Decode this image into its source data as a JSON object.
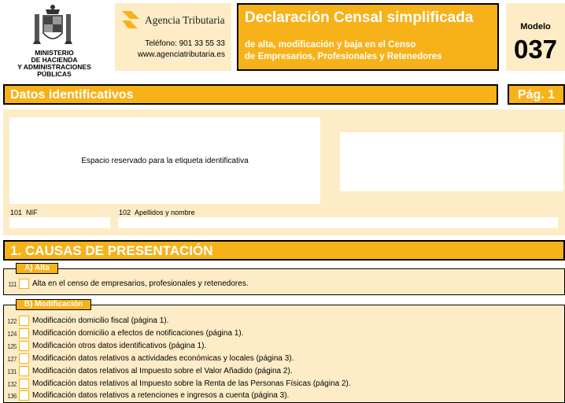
{
  "header": {
    "ministry_lines": [
      "MINISTERIO",
      "DE HACIENDA",
      "Y ADMINISTRACIONES PÚBLICAS"
    ],
    "agency_name": "Agencia Tributaria",
    "agency_phone": "Teléfono: 901 33 55 33",
    "agency_web": "www.agenciatributaria.es",
    "title": "Declaración Censal simplificada",
    "subtitle_line1": "de alta, modificación y baja en el Censo",
    "subtitle_line2": "de Empresarios, Profesionales y Retenedores",
    "model_label": "Modelo",
    "model_number": "037"
  },
  "ident": {
    "section_title": "Datos identificativos",
    "page_label": "Pág. 1",
    "label_space_text": "Espacio reservado para la etiqueta identificativa",
    "nif_code": "101",
    "nif_label": "NIF",
    "name_code": "102",
    "name_label": "Apellidos y nombre"
  },
  "causes": {
    "title": "1. CAUSAS DE PRESENTACIÓN",
    "alta": {
      "heading": "A) Alta",
      "items": [
        {
          "code": "111",
          "label": "Alta en el censo de empresarios, profesionales y retenedores."
        }
      ]
    },
    "modificacion": {
      "heading": "B) Modificación",
      "items": [
        {
          "code": "122",
          "label": "Modificación domicilio fiscal (página 1)."
        },
        {
          "code": "124",
          "label": "Modificación domicilio a efectos de notificaciones (página 1)."
        },
        {
          "code": "125",
          "label": "Modificación otros datos identificativos (página 1)."
        },
        {
          "code": "127",
          "label": "Modificación datos relativos a actividades económicas y locales (página 3)."
        },
        {
          "code": "131",
          "label": "Modificación datos relativos al Impuesto sobre el Valor Añadido (página 2)."
        },
        {
          "code": "132",
          "label": "Modificación datos relativos al Impuesto sobre la Renta de las Personas Físicas (página 2)."
        },
        {
          "code": "136",
          "label": "Modificación datos relativos a retenciones e ingresos a cuenta (página 3)."
        }
      ]
    }
  },
  "colors": {
    "accent": "#f7b21a",
    "panel": "#fdecc6"
  }
}
